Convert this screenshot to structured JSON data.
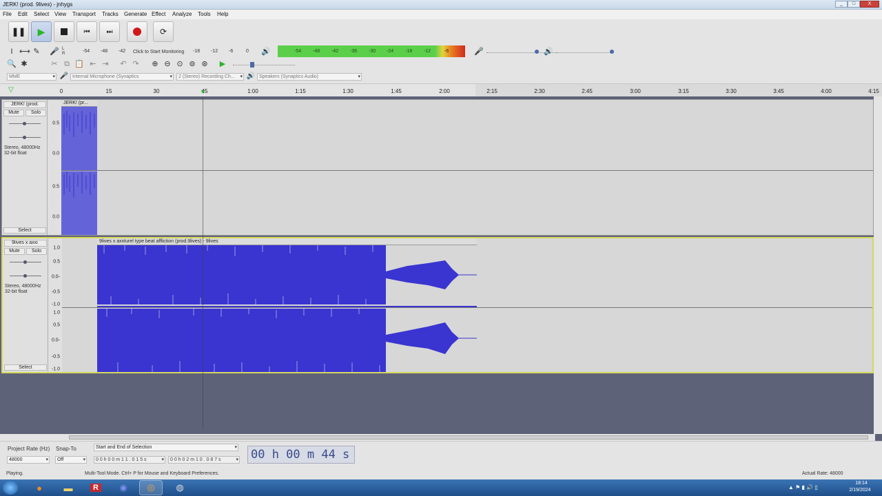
{
  "window": {
    "title": "JERK! (prod. 9lives) - jnhygs",
    "min": "_",
    "max": "□",
    "close": "X"
  },
  "menu": [
    "File",
    "Edit",
    "Select",
    "View",
    "Transport",
    "Tracks",
    "Generate",
    "Effect",
    "Analyze",
    "Tools",
    "Help"
  ],
  "meters": {
    "rec_lr": "L\nR",
    "rec_scale": [
      "-54",
      "-48",
      "-42",
      "Click to Start Monitoring",
      "-18",
      "-12",
      "-6",
      "0"
    ],
    "play_scale": [
      "-54",
      "-48",
      "-42",
      "-36",
      "-30",
      "-24",
      "-18",
      "-12",
      "-6"
    ]
  },
  "devices": {
    "host": "MME",
    "input": "Internal Microphone (Synaptics",
    "channels": "2 (Stereo) Recording Ch...",
    "output": "Speakers (Synaptics Audio)"
  },
  "ruler": {
    "ticks": [
      "0",
      "15",
      "30",
      "45",
      "1:00",
      "1:15",
      "1:30",
      "1:45",
      "2:00",
      "2:15",
      "2:30",
      "2:45",
      "3:00",
      "3:15",
      "3:30",
      "3:45",
      "4:00",
      "4:15"
    ]
  },
  "tracks": [
    {
      "name": "JERK! (prod.",
      "clip_title": "JERK! (pr...",
      "mute": "Mute",
      "solo": "Solo",
      "info1": "Stereo, 48000Hz",
      "info2": "32-bit float",
      "select": "Select",
      "scale_top": [
        "0.5",
        "0.0"
      ],
      "scale_bot": [
        "0.5",
        "0.0"
      ]
    },
    {
      "name": "9lives x axxi",
      "clip_title": "9lives x axxturel type beat affliction (prod.9lives) - 9lives",
      "mute": "Mute",
      "solo": "Solo",
      "info1": "Stereo, 48000Hz",
      "info2": "32-bit float",
      "select": "Select",
      "scale_top": [
        "1.0",
        "0.5",
        "0.0-",
        "-0.5",
        "-1.0"
      ],
      "scale_bot": [
        "1.0",
        "0.5",
        "0.0-",
        "-0.5",
        "-1.0"
      ]
    }
  ],
  "selection_bar": {
    "project_rate_label": "Project Rate (Hz)",
    "project_rate": "48000",
    "snap_label": "Snap-To",
    "snap": "Off",
    "mode": "Start and End of Selection",
    "start": "0 0 h 0 0 m 1 1 . 0 1 5 s",
    "end": "0 0 h 0 2 m 1 0 . 0 8 7 s",
    "time": "00 h 00 m 44 s"
  },
  "status": {
    "left": "Playing.",
    "middle": "Multi-Tool Mode. Ctrl+ P for Mouse and Keyboard Preferences.",
    "right": "Actual Rate: 48000"
  },
  "taskbar": {
    "time": "18:14",
    "date": "2/19/2024"
  },
  "colors": {
    "wave": "#3a34d0",
    "meter_green": "#5ccf4a",
    "record": "#d01818",
    "play": "#2bb52b"
  }
}
